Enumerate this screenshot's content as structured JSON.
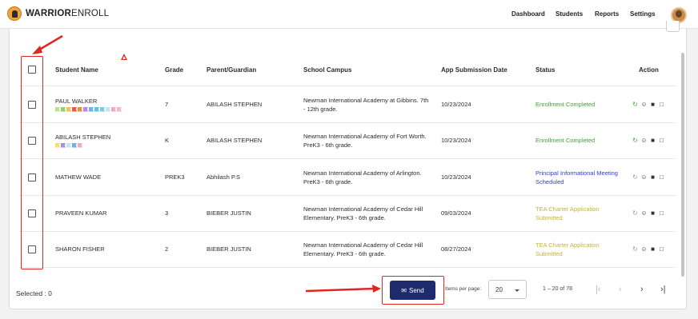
{
  "app": {
    "logo_bold": "WARRIOR",
    "logo_light": "ENROLL"
  },
  "nav": [
    {
      "label": "Dashboard"
    },
    {
      "label": "Students"
    },
    {
      "label": "Reports"
    },
    {
      "label": "Settings"
    }
  ],
  "table": {
    "headers": {
      "student": "Student Name",
      "grade": "Grade",
      "parent": "Parent/Guardian",
      "campus": "School Campus",
      "date": "App Submission Date",
      "status": "Status",
      "action": "Action"
    },
    "rows": [
      {
        "student": "PAUL WALKER",
        "grade": "7",
        "parent": "ABILASH STEPHEN",
        "campus": "Newman International Academy at Gibbins. 7th - 12th grade.",
        "date": "10/23/2024",
        "status": "Enrollment Completed",
        "status_color": "#3aa832",
        "flags": [
          "#b6e48a",
          "#8ed07a",
          "#f2c14e",
          "#e85a4a",
          "#f08a3c",
          "#b48ae0",
          "#6fb0ea",
          "#5fc6d8",
          "#7ec8e8",
          "#c0e6f4",
          "#f4a8c4",
          "#f7b8c8"
        ]
      },
      {
        "student": "ABILASH STEPHEN",
        "grade": "K",
        "parent": "ABILASH STEPHEN",
        "campus": "Newman International Academy of Fort Worth. PreK3 - 6th grade.",
        "date": "10/23/2024",
        "status": "Enrollment Completed",
        "status_color": "#3aa832",
        "flags": [
          "#f4e06a",
          "#b48ae0",
          "#c0e6f4",
          "#6fb0ea",
          "#f4a8c4"
        ]
      },
      {
        "student": "MATHEW WADE",
        "grade": "PREK3",
        "parent": "Abhilash P.S",
        "campus": "Newman International Academy of Arlington. PreK3 - 6th grade.",
        "date": "10/23/2024",
        "status": "Principal Informational Meeting Scheduled",
        "status_color": "#2a3fd0",
        "flags": []
      },
      {
        "student": "PRAVEEN KUMAR",
        "grade": "3",
        "parent": "BIEBER JUSTIN",
        "campus": "Newman International Academy of Cedar Hill Elementary. PreK3 - 6th grade.",
        "date": "09/03/2024",
        "status": "TEA Charter Application Submitted",
        "status_color": "#c8b430",
        "flags": []
      },
      {
        "student": "SHARON FISHER",
        "grade": "2",
        "parent": "BIEBER JUSTIN",
        "campus": "Newman International Academy of Cedar Hill Elementary. PreK3 - 6th grade.",
        "date": "08/27/2024",
        "status": "TEA Charter Application Submitted",
        "status_color": "#c8b430",
        "flags": []
      }
    ],
    "action_icons": [
      "refresh-icon",
      "person-icon",
      "trash-icon",
      "note-icon"
    ]
  },
  "footer": {
    "selected": "Selected : 0",
    "send_label": "Send",
    "items_per_page_label": "Items per page:",
    "items_per_page_value": "20",
    "range": "1 – 20 of 78"
  },
  "colors": {
    "send_button": "#1d2a6b",
    "annotation_red": "#e0271f"
  }
}
